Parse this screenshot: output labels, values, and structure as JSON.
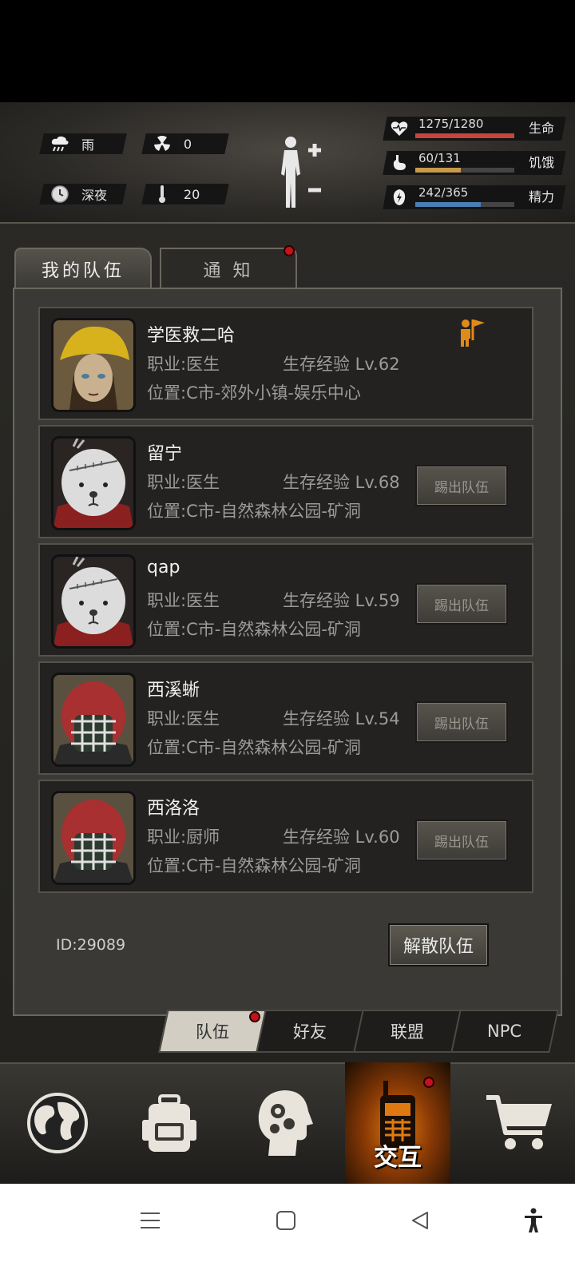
{
  "status": {
    "weather": {
      "label": "雨",
      "icon": "rain-cloud-icon"
    },
    "radiation": {
      "value": "0",
      "icon": "radiation-icon"
    },
    "time": {
      "label": "深夜",
      "icon": "clock-icon"
    },
    "temperature": {
      "value": "20",
      "icon": "thermometer-icon"
    },
    "stats": [
      {
        "name": "生命",
        "text": "1275/1280",
        "fraction": 0.996,
        "color": "#c8443c",
        "icon": "heart-pulse-icon"
      },
      {
        "name": "饥饿",
        "text": "60/131",
        "fraction": 0.458,
        "color": "#c89a4a",
        "icon": "stomach-icon"
      },
      {
        "name": "精力",
        "text": "242/365",
        "fraction": 0.663,
        "color": "#4a7fb4",
        "icon": "energy-icon"
      }
    ]
  },
  "tabs": {
    "my_team": "我的队伍",
    "notice": "通 知"
  },
  "members": [
    {
      "name": "学医救二哈",
      "job": "职业:医生",
      "xp": "生存经验 Lv.62",
      "location": "位置:C市-郊外小镇-娱乐中心",
      "leader": true,
      "avatar": "yellow-hat-avatar"
    },
    {
      "name": "留宁",
      "job": "职业:医生",
      "xp": "生存经验 Lv.68",
      "location": "位置:C市-自然森林公园-矿洞",
      "kick": "踢出队伍",
      "avatar": "bear-mask-avatar"
    },
    {
      "name": "qap",
      "job": "职业:医生",
      "xp": "生存经验 Lv.59",
      "location": "位置:C市-自然森林公园-矿洞",
      "kick": "踢出队伍",
      "avatar": "bear-mask-avatar"
    },
    {
      "name": "西溪蜥",
      "job": "职业:医生",
      "xp": "生存经验 Lv.54",
      "location": "位置:C市-自然森林公园-矿洞",
      "kick": "踢出队伍",
      "avatar": "football-helmet-avatar"
    },
    {
      "name": "西洛洛",
      "job": "职业:厨师",
      "xp": "生存经验 Lv.60",
      "location": "位置:C市-自然森林公园-矿洞",
      "kick": "踢出队伍",
      "avatar": "football-helmet-avatar"
    }
  ],
  "team_id": "ID:29089",
  "disband": "解散队伍",
  "subtabs": [
    "队伍",
    "好友",
    "联盟",
    "NPC"
  ],
  "nav": {
    "interact_label": "交互",
    "active_color": "#e07a10"
  },
  "colors": {
    "alert_dot": "#c3121a",
    "leader_flag": "#e08a18"
  }
}
